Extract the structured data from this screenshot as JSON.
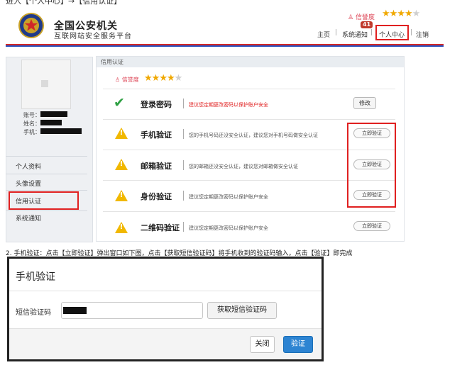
{
  "top_caption": "进入【个人中心】→【信用认证】",
  "header": {
    "brand_title": "全国公安机关",
    "brand_subtitle": "互联网站安全服务平台",
    "credit_label": "信誉度",
    "rating": 4,
    "rating_max": 5,
    "notification_count": "41",
    "nav": [
      "主页",
      "系统通知",
      "个人中心",
      "注销"
    ],
    "nav_separator": "|"
  },
  "sidebar": {
    "account_label": "账号：",
    "name_label": "姓名：",
    "phone_label": "手机：",
    "menu": [
      "个人资料",
      "头像设置",
      "信用认证",
      "系统通知"
    ]
  },
  "main": {
    "section_title": "信用认证",
    "credit_label": "信誉度",
    "rating": 4,
    "rows": [
      {
        "name": "登录密码",
        "status": "done",
        "desc": "建议您定期更改密码以保护账户安全",
        "action": "修改"
      },
      {
        "name": "手机验证",
        "status": "warn",
        "desc": "您的手机号码还没安全认证，建议您对手机号码做安全认证",
        "action": "立即验证"
      },
      {
        "name": "邮箱验证",
        "status": "warn",
        "desc": "您的邮箱还没安全认证，建议您对邮箱做安全认证",
        "action": "立即验证"
      },
      {
        "name": "身份验证",
        "status": "warn",
        "desc": "建议您定期更改密码以保护账户安全",
        "action": "立即验证"
      },
      {
        "name": "二维码验证",
        "status": "warn",
        "desc": "建议您定期更改密码以保护账户安全",
        "action": "立即验证"
      }
    ]
  },
  "caption": "2. 手机验证：点击【立即验证】弹出窗口如下图，点击【获取短信验证码】将手机收到的验证码输入，点击【验证】即完成",
  "dialog": {
    "title": "手机验证",
    "code_label": "短信验证码",
    "get_code_button": "获取短信验证码",
    "close_button": "关闭",
    "verify_button": "验证"
  },
  "colors": {
    "accent_red": "#d02828",
    "accent_blue": "#2850c0",
    "star": "#f0a800",
    "verify_blue": "#2d84d2"
  }
}
